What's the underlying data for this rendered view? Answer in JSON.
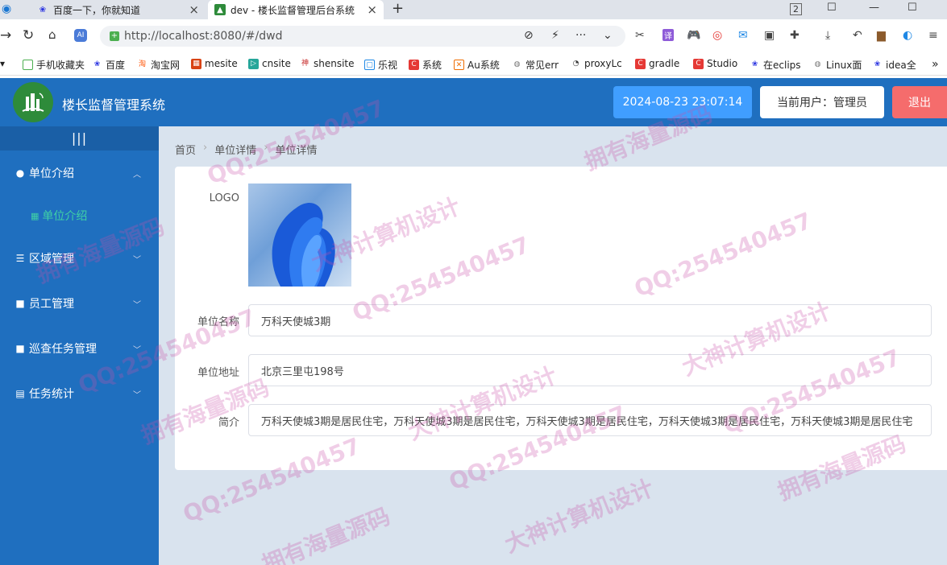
{
  "browser": {
    "tabs": [
      {
        "title": "百度一下，你就知道",
        "active": false
      },
      {
        "title": "dev - 楼长监督管理后台系统",
        "active": true
      }
    ],
    "url_host": "http://localhost",
    "url_rest": ":8080/#/dwd",
    "bookmarks": [
      "手机收藏夹",
      "百度",
      "淘宝网",
      "mesite",
      "cnsite",
      "shensite",
      "乐视",
      "系统",
      "Au系统",
      "常见err",
      "proxyLc",
      "gradle",
      "Studio",
      "在eclips",
      "Linux面",
      "idea全"
    ]
  },
  "app": {
    "title": "楼长监督管理系统",
    "datetime": "2024-08-23 23:07:14",
    "current_user": "当前用户：管理员",
    "logout": "退出"
  },
  "sidebar": {
    "collapse": "|||",
    "items": [
      {
        "label": "单位介绍",
        "icon": "user-icon",
        "expanded": true
      },
      {
        "label": "区域管理",
        "icon": "sliders-icon"
      },
      {
        "label": "员工管理",
        "icon": "lock-icon"
      },
      {
        "label": "巡查任务管理",
        "icon": "lock-icon"
      },
      {
        "label": "任务统计",
        "icon": "document-icon"
      }
    ],
    "subitem": {
      "label": "单位介绍",
      "icon": "grid-icon"
    }
  },
  "breadcrumb": [
    "首页",
    "单位详情",
    "单位详情"
  ],
  "form": {
    "logo_label": "LOGO",
    "name_label": "单位名称",
    "name_value": "万科天使城3期",
    "address_label": "单位地址",
    "address_value": "北京三里屯198号",
    "intro_label": "简介",
    "intro_value": "万科天使城3期是居民住宅，万科天使城3期是居民住宅，万科天使城3期是居民住宅，万科天使城3期是居民住宅，万科天使城3期是居民住宅"
  },
  "watermarks": {
    "qq": "QQ:254540457",
    "design": "大神计算机设计",
    "source": "拥有海量源码"
  },
  "colors": {
    "header": "#1f6fbf",
    "date_box": "#409eff",
    "logout": "#f56c6c",
    "submenu_active": "#3fd0a6"
  }
}
